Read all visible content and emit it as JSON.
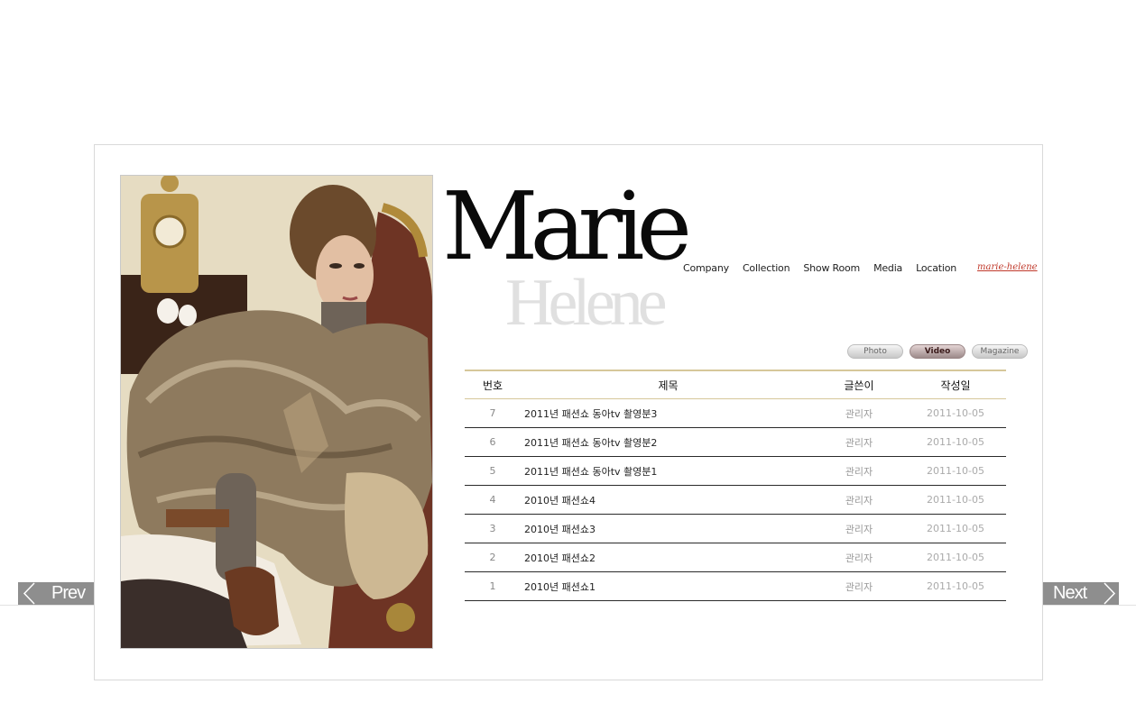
{
  "logo": {
    "main": "Marie",
    "sub": "Helene"
  },
  "nav": {
    "items": [
      {
        "label": "Company"
      },
      {
        "label": "Collection"
      },
      {
        "label": "Show Room"
      },
      {
        "label": "Media"
      },
      {
        "label": "Location"
      }
    ],
    "brand": "marie-helene"
  },
  "media_tabs": {
    "photo": "Photo",
    "video": "Video",
    "magazine": "Magazine",
    "active": "Video"
  },
  "table": {
    "headers": {
      "num": "번호",
      "title": "제목",
      "writer": "글쓴이",
      "date": "작성일"
    },
    "rows": [
      {
        "num": "7",
        "title": "2011년 패션쇼 동아tv 촬영분3",
        "writer": "관리자",
        "date": "2011-10-05"
      },
      {
        "num": "6",
        "title": "2011년 패션쇼 동아tv 촬영분2",
        "writer": "관리자",
        "date": "2011-10-05"
      },
      {
        "num": "5",
        "title": "2011년 패션쇼 동아tv 촬영분1",
        "writer": "관리자",
        "date": "2011-10-05"
      },
      {
        "num": "4",
        "title": "2010년 패션쇼4",
        "writer": "관리자",
        "date": "2011-10-05"
      },
      {
        "num": "3",
        "title": "2010년 패션쇼3",
        "writer": "관리자",
        "date": "2011-10-05"
      },
      {
        "num": "2",
        "title": "2010년 패션쇼2",
        "writer": "관리자",
        "date": "2011-10-05"
      },
      {
        "num": "1",
        "title": "2010년 패션쇼1",
        "writer": "관리자",
        "date": "2011-10-05"
      }
    ]
  },
  "pager": {
    "prev": "Prev",
    "next": "Next"
  },
  "colors": {
    "accent_line": "#d6c79a",
    "brand_red": "#c0392b",
    "pager_bg": "#8e8e8e"
  }
}
